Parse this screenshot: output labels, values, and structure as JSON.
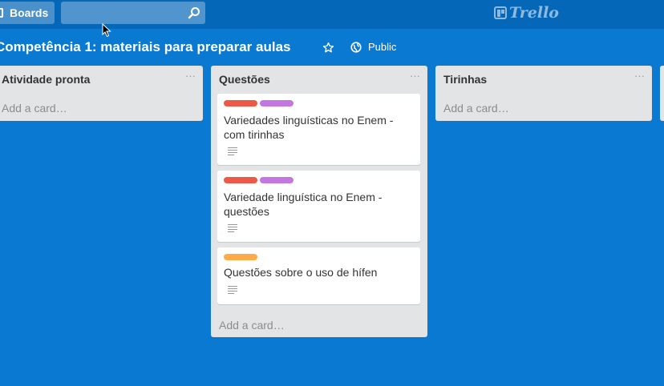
{
  "header": {
    "boards_label": "Boards",
    "search_value": "",
    "logo_text": "Trello"
  },
  "board": {
    "title": "Competência 1: materiais para preparar aulas",
    "visibility": "Public",
    "background": "#0a79d2"
  },
  "lists": [
    {
      "name": "Atividade pronta",
      "add_card_label": "Add a card…",
      "cards": []
    },
    {
      "name": "Questões",
      "add_card_label": "Add a card…",
      "cards": [
        {
          "title_line1": "Variedades linguísticas no Enem -",
          "title_line2": "com tirinhas",
          "labels": [
            "#eb5a46",
            "#c377e0"
          ],
          "has_description": true
        },
        {
          "title_line1": "Variedade linguística no Enem -",
          "title_line2": "questões",
          "labels": [
            "#eb5a46",
            "#c377e0"
          ],
          "has_description": true
        },
        {
          "title_line1": "Questões sobre o uso de hífen",
          "title_line2": "",
          "labels": [
            "#ffab4a"
          ],
          "has_description": true
        }
      ]
    },
    {
      "name": "Tirinhas",
      "add_card_label": "Add a card…",
      "cards": []
    }
  ],
  "list_menu_glyph": "···",
  "colors": {
    "topbar": "#0567b8",
    "list_bg": "#e2e4e6",
    "label_red": "#eb5a46",
    "label_purple": "#c377e0",
    "label_orange": "#ffab4a"
  }
}
